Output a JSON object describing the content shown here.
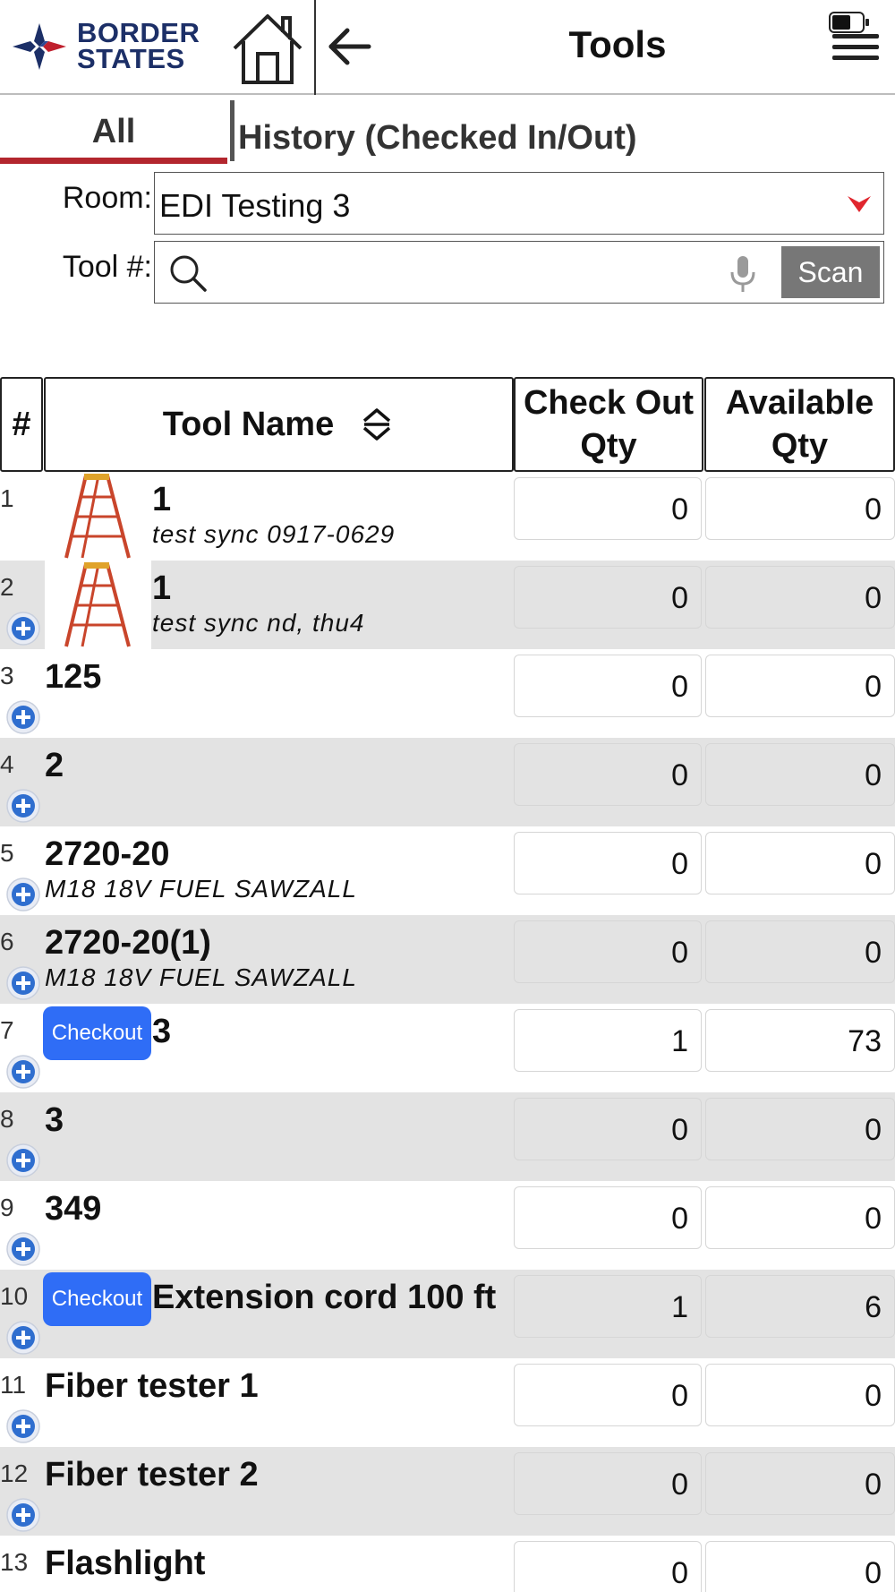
{
  "header": {
    "logo_line1": "BORDER",
    "logo_line2": "STATES",
    "title": "Tools",
    "icons": {
      "home": "home-icon",
      "back": "back-arrow-icon",
      "menu": "hamburger-menu-icon",
      "battery": "battery-icon"
    },
    "colors": {
      "logo_navy": "#1c2f67",
      "logo_red": "#c0202e"
    }
  },
  "tabs": [
    {
      "label": "All",
      "active": true
    },
    {
      "label": "History (Checked In/Out)",
      "active": false
    }
  ],
  "filters": {
    "room_label": "Room:",
    "room_value": "EDI Testing 3",
    "tool_label": "Tool #:",
    "tool_placeholder": "",
    "scan_label": "Scan"
  },
  "table": {
    "headers": {
      "num": "#",
      "name": "Tool Name",
      "check_out_qty": "Check Out Qty",
      "available_qty": "Available Qty"
    },
    "checkout_label": "Checkout",
    "rows": [
      {
        "num": "1",
        "name": "1",
        "desc": "test sync 0917-0629",
        "thumb": "ladder",
        "checkout": false,
        "add": false,
        "check_out_qty": "0",
        "available_qty": "0"
      },
      {
        "num": "2",
        "name": "1",
        "desc": "test sync nd, thu4",
        "thumb": "ladder",
        "checkout": false,
        "add": true,
        "check_out_qty": "0",
        "available_qty": "0"
      },
      {
        "num": "3",
        "name": "125",
        "desc": "",
        "thumb": "",
        "checkout": false,
        "add": true,
        "check_out_qty": "0",
        "available_qty": "0"
      },
      {
        "num": "4",
        "name": "2",
        "desc": "",
        "thumb": "",
        "checkout": false,
        "add": true,
        "check_out_qty": "0",
        "available_qty": "0"
      },
      {
        "num": "5",
        "name": "2720-20",
        "desc": "M18 18V FUEL SAWZALL",
        "thumb": "",
        "checkout": false,
        "add": true,
        "check_out_qty": "0",
        "available_qty": "0"
      },
      {
        "num": "6",
        "name": "2720-20(1)",
        "desc": "M18 18V FUEL SAWZALL",
        "thumb": "",
        "checkout": false,
        "add": true,
        "check_out_qty": "0",
        "available_qty": "0"
      },
      {
        "num": "7",
        "name": "3",
        "desc": "",
        "thumb": "",
        "checkout": true,
        "add": true,
        "check_out_qty": "1",
        "available_qty": "73"
      },
      {
        "num": "8",
        "name": "3",
        "desc": "",
        "thumb": "",
        "checkout": false,
        "add": true,
        "check_out_qty": "0",
        "available_qty": "0"
      },
      {
        "num": "9",
        "name": "349",
        "desc": "",
        "thumb": "",
        "checkout": false,
        "add": true,
        "check_out_qty": "0",
        "available_qty": "0"
      },
      {
        "num": "10",
        "name": "Extension cord 100 ft",
        "desc": "",
        "thumb": "",
        "checkout": true,
        "add": true,
        "check_out_qty": "1",
        "available_qty": "6"
      },
      {
        "num": "11",
        "name": "Fiber tester 1",
        "desc": "",
        "thumb": "",
        "checkout": false,
        "add": true,
        "check_out_qty": "0",
        "available_qty": "0"
      },
      {
        "num": "12",
        "name": "Fiber tester 2",
        "desc": "",
        "thumb": "",
        "checkout": false,
        "add": true,
        "check_out_qty": "0",
        "available_qty": "0"
      },
      {
        "num": "13",
        "name": "Flashlight",
        "desc": "",
        "thumb": "",
        "checkout": false,
        "add": false,
        "check_out_qty": "0",
        "available_qty": "0"
      }
    ]
  },
  "colors": {
    "accent_red": "#b3262e",
    "checkout_blue": "#2f6df6",
    "row_alt": "#e3e3e3"
  }
}
